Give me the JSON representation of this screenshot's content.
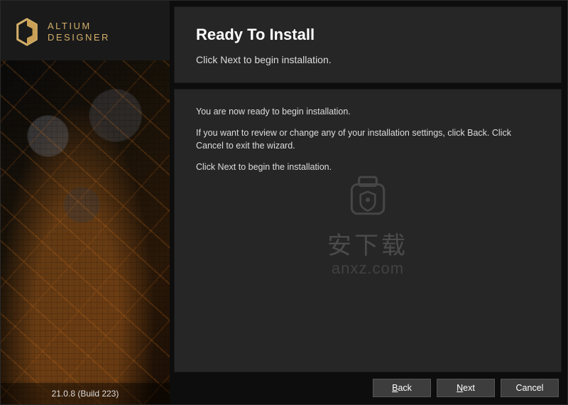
{
  "branding": {
    "name_line1": "ALTIUM",
    "name_line2": "DESIGNER",
    "version": "21.0.8 (Build 223)"
  },
  "header": {
    "title": "Ready To Install",
    "subtitle": "Click Next to begin installation."
  },
  "body": {
    "line1": "You are now ready to begin installation.",
    "line2": "If you want to review or change any of your installation settings, click Back. Click Cancel to exit the wizard.",
    "line3": "Click Next to begin the installation."
  },
  "watermark": {
    "cn": "安下载",
    "en": "anxz.com"
  },
  "buttons": {
    "back": "Back",
    "next": "Next",
    "cancel": "Cancel"
  }
}
